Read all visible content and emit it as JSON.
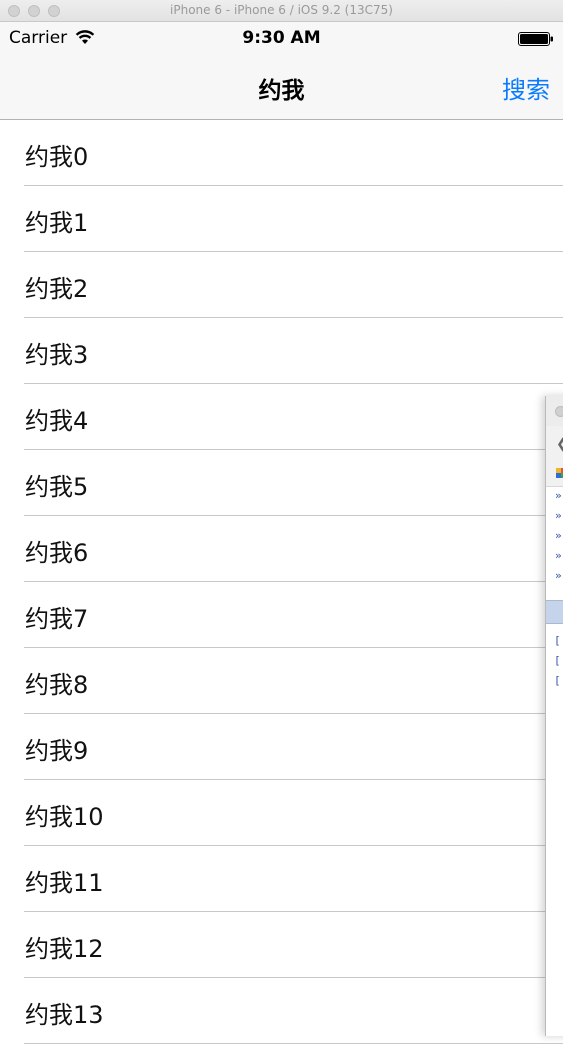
{
  "window": {
    "title": "iPhone 6 - iPhone 6 / iOS 9.2 (13C75)"
  },
  "statusbar": {
    "carrier": "Carrier",
    "time": "9:30 AM",
    "wifi_icon": "wifi-icon",
    "battery_icon": "battery-icon"
  },
  "navbar": {
    "title": "约我",
    "search_label": "搜索",
    "accent": "#0a7aff"
  },
  "rows": [
    "约我0",
    "约我1",
    "约我2",
    "约我3",
    "约我4",
    "约我5",
    "约我6",
    "约我7",
    "约我8",
    "约我9",
    "约我10",
    "约我11",
    "约我12",
    "约我13"
  ],
  "overlay": {
    "markers": [
      "»",
      "»",
      "»",
      "»",
      "»"
    ],
    "log_lines": [
      "[",
      "[",
      "["
    ]
  }
}
